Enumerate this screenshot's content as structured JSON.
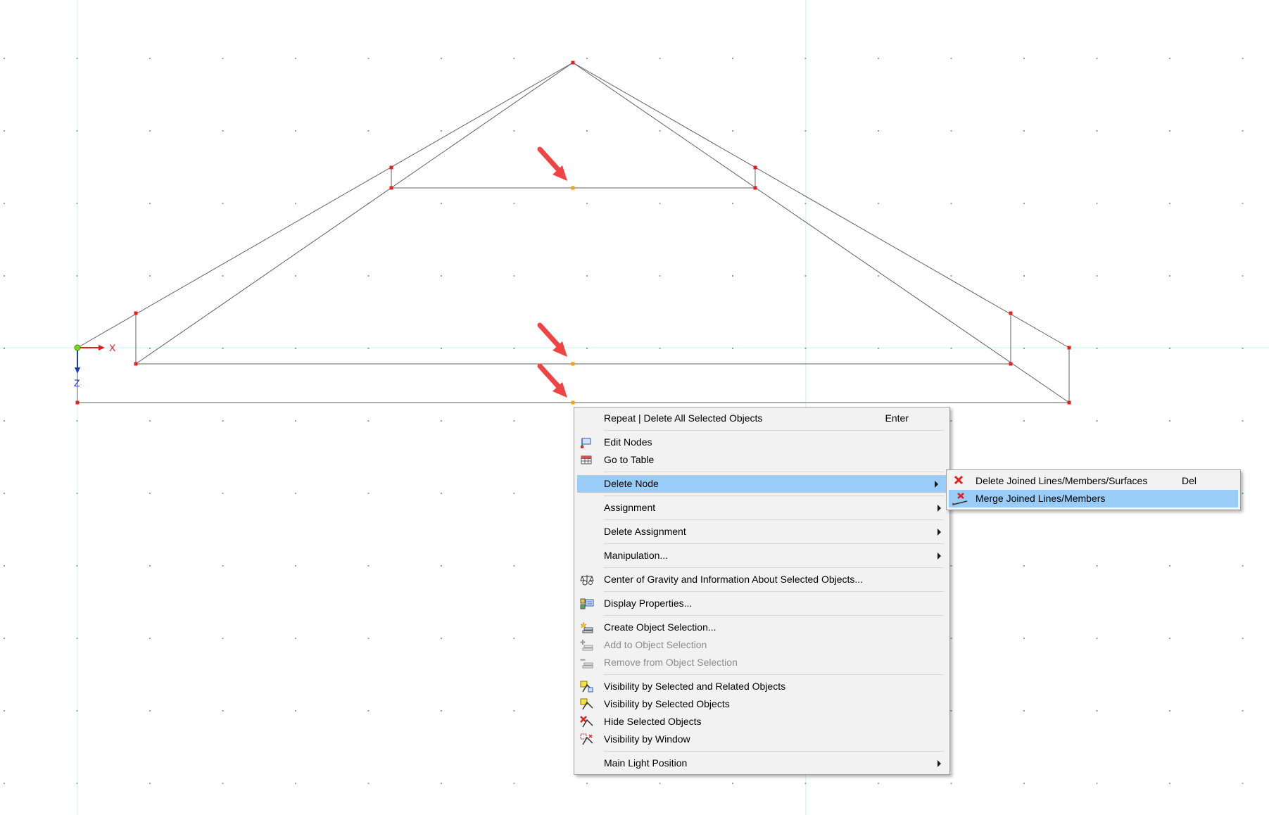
{
  "axes": {
    "x_label": "X",
    "z_label": "Z"
  },
  "context_menu": {
    "items": [
      {
        "label": "Repeat | Delete All Selected Objects",
        "shortcut": "Enter",
        "icon": "none"
      },
      {
        "label": "Edit Nodes",
        "icon": "edit-nodes-icon"
      },
      {
        "label": "Go to Table",
        "icon": "table-icon"
      },
      {
        "label": "Delete Node",
        "icon": "none",
        "submenu": true,
        "highlighted": true
      },
      {
        "label": "Assignment",
        "icon": "none",
        "submenu": true
      },
      {
        "label": "Delete Assignment",
        "icon": "none",
        "submenu": true
      },
      {
        "label": "Manipulation...",
        "icon": "none",
        "submenu": true
      },
      {
        "label": "Center of Gravity and Information About Selected Objects...",
        "icon": "scale-icon"
      },
      {
        "label": "Display Properties...",
        "icon": "display-properties-icon"
      },
      {
        "label": "Create Object Selection...",
        "icon": "create-selection-icon"
      },
      {
        "label": "Add to Object Selection",
        "icon": "add-selection-icon",
        "disabled": true
      },
      {
        "label": "Remove from Object Selection",
        "icon": "remove-selection-icon",
        "disabled": true
      },
      {
        "label": "Visibility by Selected and Related Objects",
        "icon": "visibility-related-icon"
      },
      {
        "label": "Visibility by Selected Objects",
        "icon": "visibility-selected-icon"
      },
      {
        "label": "Hide Selected Objects",
        "icon": "hide-objects-icon"
      },
      {
        "label": "Visibility by Window",
        "icon": "visibility-window-icon"
      },
      {
        "label": "Main Light Position",
        "icon": "none",
        "submenu": true
      }
    ]
  },
  "submenu": {
    "items": [
      {
        "label": "Delete Joined Lines/Members/Surfaces",
        "shortcut": "Del",
        "icon": "delete-x-icon"
      },
      {
        "label": "Merge Joined Lines/Members",
        "icon": "merge-lines-icon",
        "highlighted": true
      }
    ]
  },
  "colors": {
    "node": "#e32020",
    "selected_node": "#e8a317",
    "line": "#606060",
    "axis_x": "#e02020",
    "axis_z": "#1a3fb8",
    "annotation_arrow": "#ef4444",
    "menu_highlight": "#99cdf8"
  }
}
